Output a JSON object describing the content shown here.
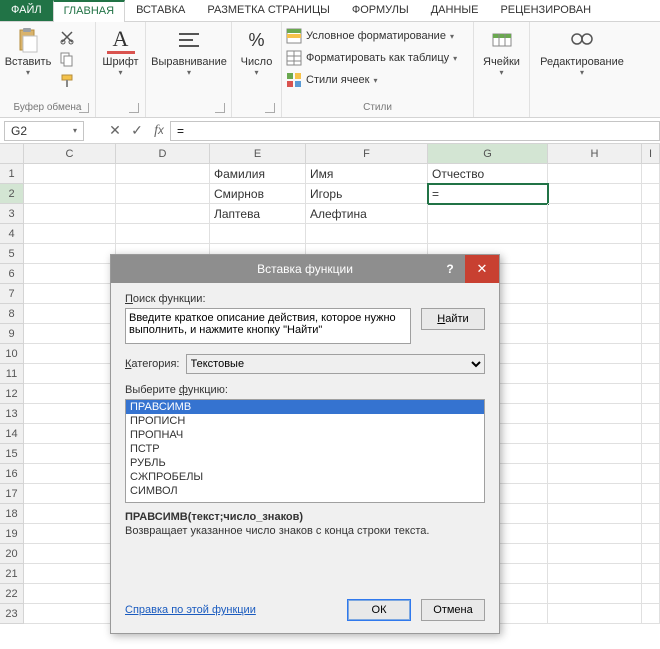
{
  "tabs": {
    "file": "ФАЙЛ",
    "home": "ГЛАВНАЯ",
    "insert": "ВСТАВКА",
    "layout": "РАЗМЕТКА СТРАНИЦЫ",
    "formulas": "ФОРМУЛЫ",
    "data": "ДАННЫЕ",
    "review": "РЕЦЕНЗИРОВАН"
  },
  "ribbon": {
    "paste": "Вставить",
    "clipboard": "Буфер обмена",
    "font": "Шрифт",
    "alignment": "Выравнивание",
    "number": "Число",
    "cond_format": "Условное форматирование",
    "format_table": "Форматировать как таблицу",
    "cell_styles": "Стили ячеек",
    "styles": "Стили",
    "cells": "Ячейки",
    "editing": "Редактирование"
  },
  "fxbar": {
    "name": "G2",
    "formula": "="
  },
  "cols": [
    "C",
    "D",
    "E",
    "F",
    "G",
    "H",
    "I"
  ],
  "sheet": {
    "E1": "Фамилия",
    "F1": "Имя",
    "G1": "Отчество",
    "E2": "Смирнов",
    "F2": "Игорь",
    "G2": "=",
    "E3": "Лаптева",
    "F3": "Алефтина"
  },
  "dialog": {
    "title": "Вставка функции",
    "search_label": "Поиск функции:",
    "search_text": "Введите краткое описание действия, которое нужно выполнить, и нажмите кнопку \"Найти\"",
    "find": "Найти",
    "category_label": "Категория:",
    "category_value": "Текстовые",
    "select_label": "Выберите функцию:",
    "functions": [
      "ПРАВСИМВ",
      "ПРОПИСН",
      "ПРОПНАЧ",
      "ПСТР",
      "РУБЛЬ",
      "СЖПРОБЕЛЫ",
      "СИМВОЛ"
    ],
    "signature": "ПРАВСИМВ(текст;число_знаков)",
    "description": "Возвращает указанное число знаков с конца строки текста.",
    "help": "Справка по этой функции",
    "ok": "ОК",
    "cancel": "Отмена"
  }
}
